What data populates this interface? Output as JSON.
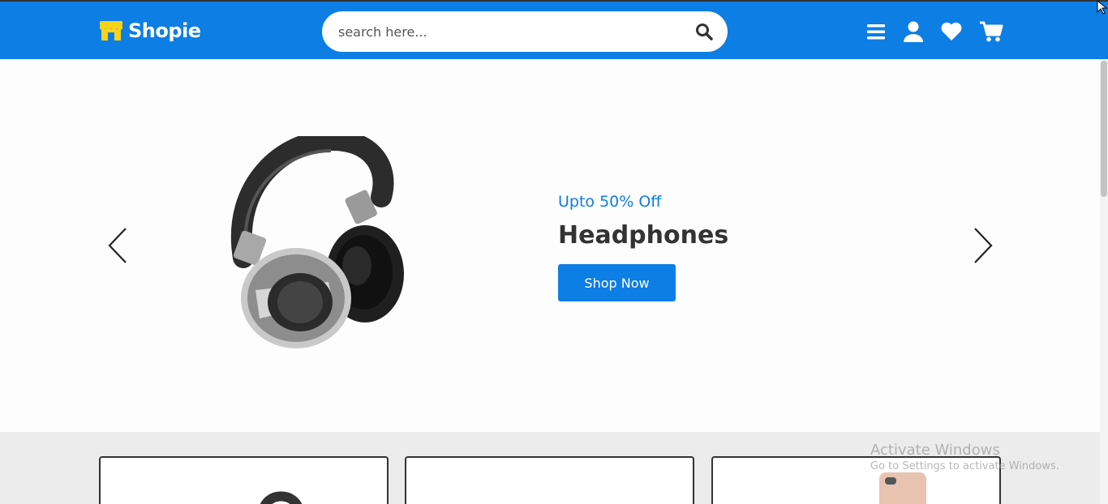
{
  "header": {
    "logo_text": "Shopie",
    "search_placeholder": "search here...",
    "icons": [
      "menu-icon",
      "user-icon",
      "heart-icon",
      "cart-icon"
    ],
    "bg_color": "#0d7ee4"
  },
  "hero": {
    "subtitle": "Upto 50% Off",
    "title": "Headphones",
    "button_label": "Shop Now",
    "accent_color": "#0d7ee4"
  },
  "watermark": {
    "title": "Activate Windows",
    "subtitle": "Go to Settings to activate Windows."
  }
}
